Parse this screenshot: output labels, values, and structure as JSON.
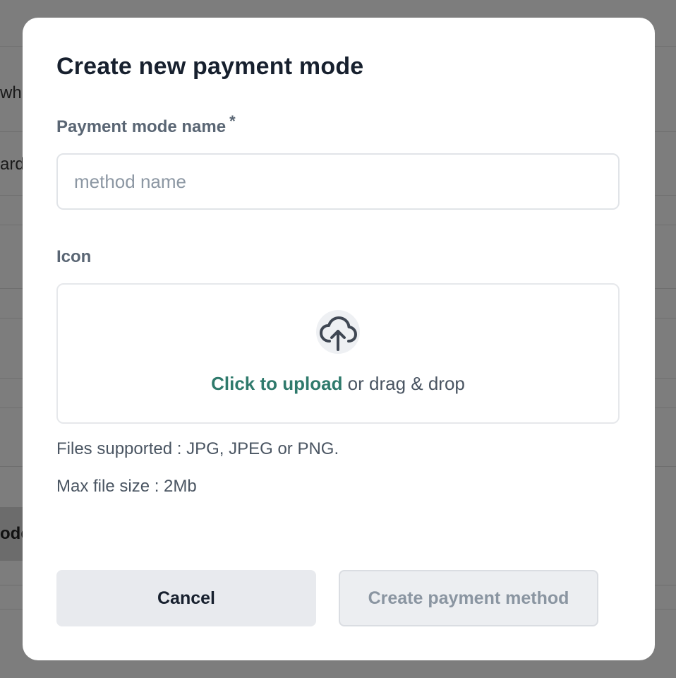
{
  "background": {
    "fragments": [
      "wh",
      "ard",
      "ode"
    ]
  },
  "modal": {
    "title": "Create new payment mode",
    "name_field": {
      "label": "Payment mode name",
      "required_mark": "*",
      "value": "",
      "placeholder": "method name"
    },
    "icon_field": {
      "label": "Icon",
      "upload_link": "Click to upload",
      "upload_rest": " or drag & drop",
      "icon": "cloud-upload-icon"
    },
    "hints": {
      "supported": "Files supported : JPG, JPEG or PNG.",
      "max_size": "Max file size : 2Mb"
    },
    "buttons": {
      "cancel": "Cancel",
      "create": "Create payment method"
    }
  },
  "colors": {
    "overlay": "#7d7d7d",
    "title": "#17202e",
    "label": "#5a6674",
    "link": "#2f7a6c",
    "button_secondary_bg": "#e8eaee",
    "button_disabled_text": "#8a95a1"
  }
}
